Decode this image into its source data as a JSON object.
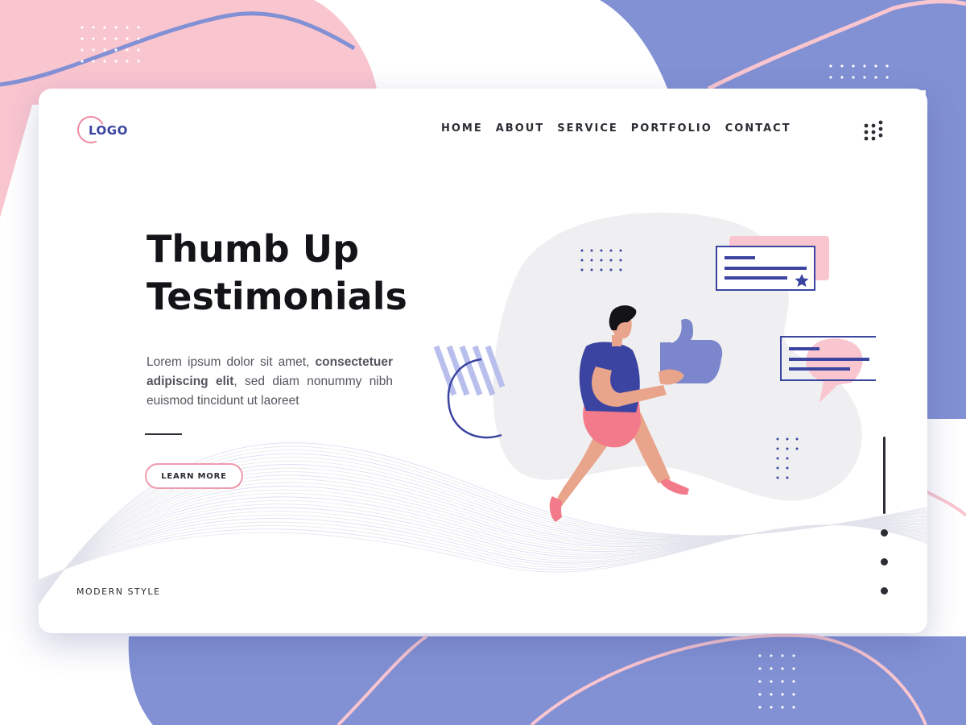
{
  "brand": {
    "logo_text": "LOGO"
  },
  "nav": {
    "items": [
      {
        "label": "HOME"
      },
      {
        "label": "ABOUT"
      },
      {
        "label": "SERVICE"
      },
      {
        "label": "PORTFOLIO"
      },
      {
        "label": "CONTACT"
      }
    ]
  },
  "hero": {
    "title_line1": "Thumb Up",
    "title_line2": "Testimonials",
    "desc_part1": "Lorem ipsum dolor sit amet, ",
    "desc_bold": "consectetuer adipiscing elit",
    "desc_part2": ", sed diam nonummy nibh euismod tincidunt ut laoreet",
    "button_label": "LEARN MORE"
  },
  "footer_label": "MODERN STYLE",
  "icons": {
    "menu": "grid-dots-icon",
    "pager": "pager-dot-icon"
  },
  "colors": {
    "pink": "#f9c5cf",
    "pink_accent": "#f09aad",
    "periwinkle": "#8290d4",
    "navy": "#3b44a0",
    "text_dark": "#141418"
  }
}
